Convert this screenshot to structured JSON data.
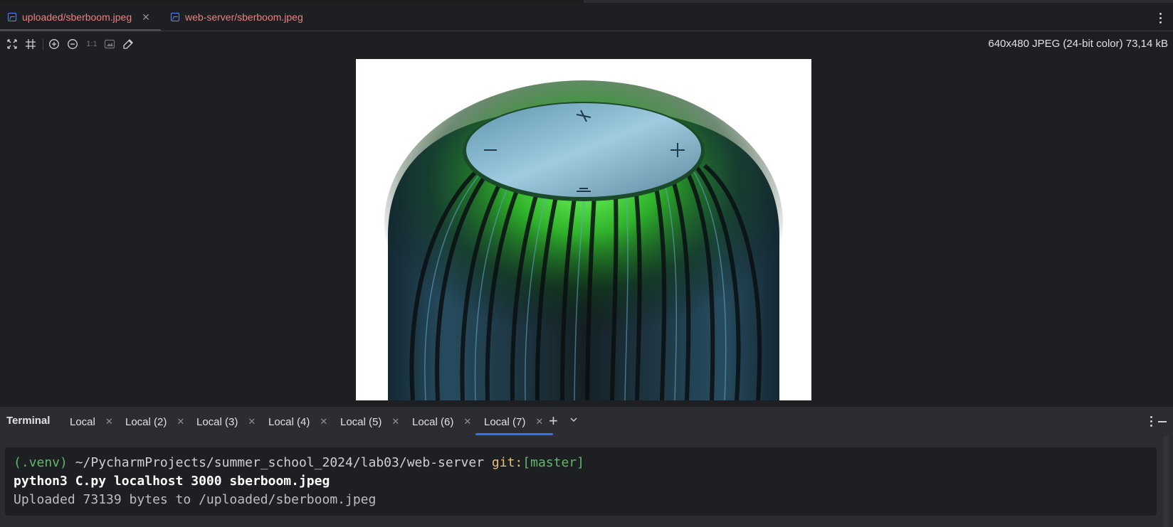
{
  "editor_tabs": [
    {
      "label": "uploaded/sberboom.jpeg",
      "active": true,
      "icon": "image-file-icon"
    },
    {
      "label": "web-server/sberboom.jpeg",
      "active": false,
      "icon": "image-file-icon"
    }
  ],
  "image_toolbar": {
    "info": "640x480 JPEG (24-bit color) 73,14 kB",
    "actual_size_label": "1:1"
  },
  "terminal": {
    "title": "Terminal",
    "tabs": [
      {
        "label": "Local"
      },
      {
        "label": "Local (2)"
      },
      {
        "label": "Local (3)"
      },
      {
        "label": "Local (4)"
      },
      {
        "label": "Local (5)"
      },
      {
        "label": "Local (6)"
      },
      {
        "label": "Local (7)",
        "active": true
      }
    ],
    "prompt": {
      "venv": "(.venv)",
      "path": "~/PycharmProjects/summer_school_2024/lab03/web-server",
      "git_label": "git:",
      "branch": "[master]"
    },
    "command": "python3 C.py localhost 3000 sberboom.jpeg",
    "output": "Uploaded 73139 bytes to /uploaded/sberboom.jpeg"
  },
  "colors": {
    "background": "#1e1f22",
    "panel": "#2b2d30",
    "active_tab_accent": "#3574f0",
    "modified_file": "#e8837d",
    "venv_green": "#5fb865",
    "git_yellow": "#e5c07b"
  }
}
